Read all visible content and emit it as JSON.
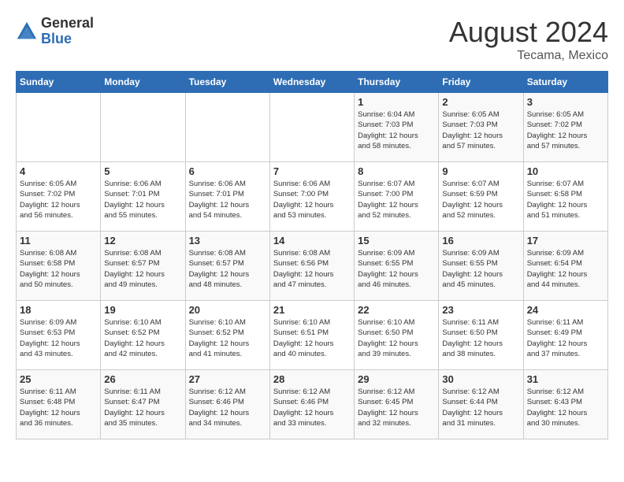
{
  "header": {
    "logo_general": "General",
    "logo_blue": "Blue",
    "month_year": "August 2024",
    "location": "Tecama, Mexico"
  },
  "days_of_week": [
    "Sunday",
    "Monday",
    "Tuesday",
    "Wednesday",
    "Thursday",
    "Friday",
    "Saturday"
  ],
  "weeks": [
    [
      {
        "day": "",
        "info": ""
      },
      {
        "day": "",
        "info": ""
      },
      {
        "day": "",
        "info": ""
      },
      {
        "day": "",
        "info": ""
      },
      {
        "day": "1",
        "info": "Sunrise: 6:04 AM\nSunset: 7:03 PM\nDaylight: 12 hours\nand 58 minutes."
      },
      {
        "day": "2",
        "info": "Sunrise: 6:05 AM\nSunset: 7:03 PM\nDaylight: 12 hours\nand 57 minutes."
      },
      {
        "day": "3",
        "info": "Sunrise: 6:05 AM\nSunset: 7:02 PM\nDaylight: 12 hours\nand 57 minutes."
      }
    ],
    [
      {
        "day": "4",
        "info": "Sunrise: 6:05 AM\nSunset: 7:02 PM\nDaylight: 12 hours\nand 56 minutes."
      },
      {
        "day": "5",
        "info": "Sunrise: 6:06 AM\nSunset: 7:01 PM\nDaylight: 12 hours\nand 55 minutes."
      },
      {
        "day": "6",
        "info": "Sunrise: 6:06 AM\nSunset: 7:01 PM\nDaylight: 12 hours\nand 54 minutes."
      },
      {
        "day": "7",
        "info": "Sunrise: 6:06 AM\nSunset: 7:00 PM\nDaylight: 12 hours\nand 53 minutes."
      },
      {
        "day": "8",
        "info": "Sunrise: 6:07 AM\nSunset: 7:00 PM\nDaylight: 12 hours\nand 52 minutes."
      },
      {
        "day": "9",
        "info": "Sunrise: 6:07 AM\nSunset: 6:59 PM\nDaylight: 12 hours\nand 52 minutes."
      },
      {
        "day": "10",
        "info": "Sunrise: 6:07 AM\nSunset: 6:58 PM\nDaylight: 12 hours\nand 51 minutes."
      }
    ],
    [
      {
        "day": "11",
        "info": "Sunrise: 6:08 AM\nSunset: 6:58 PM\nDaylight: 12 hours\nand 50 minutes."
      },
      {
        "day": "12",
        "info": "Sunrise: 6:08 AM\nSunset: 6:57 PM\nDaylight: 12 hours\nand 49 minutes."
      },
      {
        "day": "13",
        "info": "Sunrise: 6:08 AM\nSunset: 6:57 PM\nDaylight: 12 hours\nand 48 minutes."
      },
      {
        "day": "14",
        "info": "Sunrise: 6:08 AM\nSunset: 6:56 PM\nDaylight: 12 hours\nand 47 minutes."
      },
      {
        "day": "15",
        "info": "Sunrise: 6:09 AM\nSunset: 6:55 PM\nDaylight: 12 hours\nand 46 minutes."
      },
      {
        "day": "16",
        "info": "Sunrise: 6:09 AM\nSunset: 6:55 PM\nDaylight: 12 hours\nand 45 minutes."
      },
      {
        "day": "17",
        "info": "Sunrise: 6:09 AM\nSunset: 6:54 PM\nDaylight: 12 hours\nand 44 minutes."
      }
    ],
    [
      {
        "day": "18",
        "info": "Sunrise: 6:09 AM\nSunset: 6:53 PM\nDaylight: 12 hours\nand 43 minutes."
      },
      {
        "day": "19",
        "info": "Sunrise: 6:10 AM\nSunset: 6:52 PM\nDaylight: 12 hours\nand 42 minutes."
      },
      {
        "day": "20",
        "info": "Sunrise: 6:10 AM\nSunset: 6:52 PM\nDaylight: 12 hours\nand 41 minutes."
      },
      {
        "day": "21",
        "info": "Sunrise: 6:10 AM\nSunset: 6:51 PM\nDaylight: 12 hours\nand 40 minutes."
      },
      {
        "day": "22",
        "info": "Sunrise: 6:10 AM\nSunset: 6:50 PM\nDaylight: 12 hours\nand 39 minutes."
      },
      {
        "day": "23",
        "info": "Sunrise: 6:11 AM\nSunset: 6:50 PM\nDaylight: 12 hours\nand 38 minutes."
      },
      {
        "day": "24",
        "info": "Sunrise: 6:11 AM\nSunset: 6:49 PM\nDaylight: 12 hours\nand 37 minutes."
      }
    ],
    [
      {
        "day": "25",
        "info": "Sunrise: 6:11 AM\nSunset: 6:48 PM\nDaylight: 12 hours\nand 36 minutes."
      },
      {
        "day": "26",
        "info": "Sunrise: 6:11 AM\nSunset: 6:47 PM\nDaylight: 12 hours\nand 35 minutes."
      },
      {
        "day": "27",
        "info": "Sunrise: 6:12 AM\nSunset: 6:46 PM\nDaylight: 12 hours\nand 34 minutes."
      },
      {
        "day": "28",
        "info": "Sunrise: 6:12 AM\nSunset: 6:46 PM\nDaylight: 12 hours\nand 33 minutes."
      },
      {
        "day": "29",
        "info": "Sunrise: 6:12 AM\nSunset: 6:45 PM\nDaylight: 12 hours\nand 32 minutes."
      },
      {
        "day": "30",
        "info": "Sunrise: 6:12 AM\nSunset: 6:44 PM\nDaylight: 12 hours\nand 31 minutes."
      },
      {
        "day": "31",
        "info": "Sunrise: 6:12 AM\nSunset: 6:43 PM\nDaylight: 12 hours\nand 30 minutes."
      }
    ]
  ]
}
